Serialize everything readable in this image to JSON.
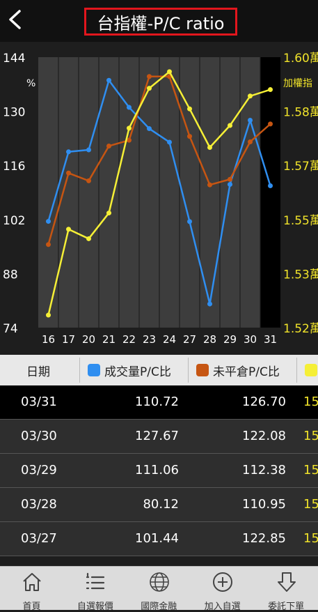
{
  "header": {
    "title": "台指權-P/C ratio"
  },
  "chart_data": {
    "type": "line",
    "x": [
      "16",
      "17",
      "20",
      "21",
      "22",
      "23",
      "24",
      "27",
      "28",
      "29",
      "30",
      "31"
    ],
    "y_left": {
      "ticks": [
        "144",
        "130",
        "116",
        "102",
        "88",
        "74"
      ],
      "unit": "%",
      "range": [
        74,
        144
      ]
    },
    "y_right": {
      "ticks": [
        "1.60萬",
        "1.58萬",
        "1.57萬",
        "1.55萬",
        "1.53萬",
        "1.52萬"
      ],
      "label": "加權指",
      "range": [
        1.52,
        1.6
      ]
    },
    "series": [
      {
        "key": "vol",
        "color": "#2f8ef0",
        "axis": "left",
        "values": [
          101.5,
          119.5,
          120.0,
          138.0,
          131.0,
          125.5,
          122.0,
          101.44,
          80.12,
          111.06,
          127.67,
          110.72
        ]
      },
      {
        "key": "oi",
        "color": "#c65512",
        "axis": "left",
        "values": [
          95.5,
          114.0,
          112.0,
          121.0,
          122.5,
          139.0,
          139.0,
          123.5,
          110.95,
          112.38,
          122.08,
          126.7
        ]
      },
      {
        "key": "idx",
        "color": "#f5ef36",
        "axis": "right",
        "values": [
          1.5237,
          1.5491,
          1.5463,
          1.5539,
          1.579,
          1.5908,
          1.5957,
          1.5847,
          1.5733,
          1.5798,
          1.5885,
          1.5904
        ]
      }
    ],
    "highlight_index": 11,
    "grid": true
  },
  "table": {
    "headers": {
      "date": "日期",
      "vol": "成交量P/C比",
      "oi": "未平倉P/C比"
    },
    "colors": {
      "vol": "#2f8ef0",
      "oi": "#c65512",
      "idx": "#f5ef36"
    },
    "rows": [
      {
        "date": "03/31",
        "vol": "110.72",
        "oi": "126.70",
        "idx": "15"
      },
      {
        "date": "03/30",
        "vol": "127.67",
        "oi": "122.08",
        "idx": "15"
      },
      {
        "date": "03/29",
        "vol": "111.06",
        "oi": "112.38",
        "idx": "15"
      },
      {
        "date": "03/28",
        "vol": "80.12",
        "oi": "110.95",
        "idx": "15"
      },
      {
        "date": "03/27",
        "vol": "101.44",
        "oi": "122.85",
        "idx": "15"
      }
    ]
  },
  "tabs": [
    {
      "label": "首頁",
      "icon": "home-icon"
    },
    {
      "label": "自選報價",
      "icon": "list-icon"
    },
    {
      "label": "國際金融",
      "icon": "globe-icon"
    },
    {
      "label": "加入自選",
      "icon": "plus-circle-icon"
    },
    {
      "label": "委託下單",
      "icon": "order-arrow-icon"
    }
  ]
}
